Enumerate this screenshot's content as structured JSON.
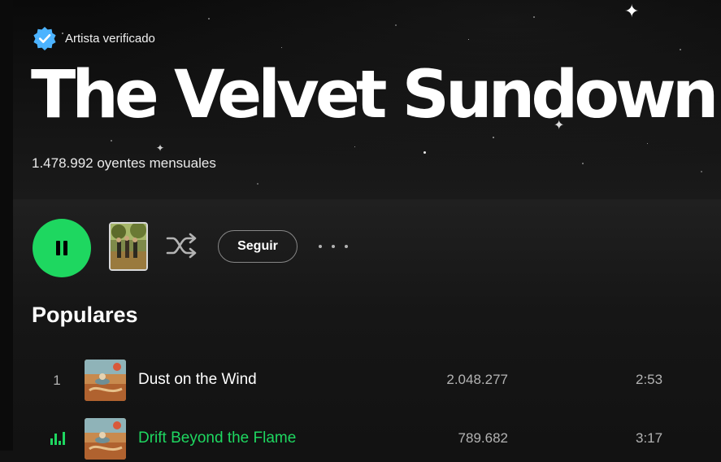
{
  "artist": {
    "verified_label": "Artista verificado",
    "name": "The Velvet Sundown",
    "monthly_listeners": "1.478.992 oyentes mensuales"
  },
  "actions": {
    "play_state": "playing",
    "play_icon": "pause-icon",
    "album_icon": "album-cover-thumbnail",
    "shuffle_icon": "shuffle-icon",
    "follow_label": "Seguir",
    "more_icon": "more-options-icon"
  },
  "popular": {
    "title": "Populares",
    "tracks": [
      {
        "index": "1",
        "title": "Dust on the Wind",
        "plays": "2.048.277",
        "duration": "2:53",
        "playing": false
      },
      {
        "index": "",
        "title": "Drift Beyond the Flame",
        "plays": "789.682",
        "duration": "3:17",
        "playing": true
      }
    ]
  },
  "colors": {
    "accent": "#1ed760",
    "verified_badge": "#4cb3ff",
    "background": "#121212",
    "secondary_text": "#b3b3b3"
  }
}
